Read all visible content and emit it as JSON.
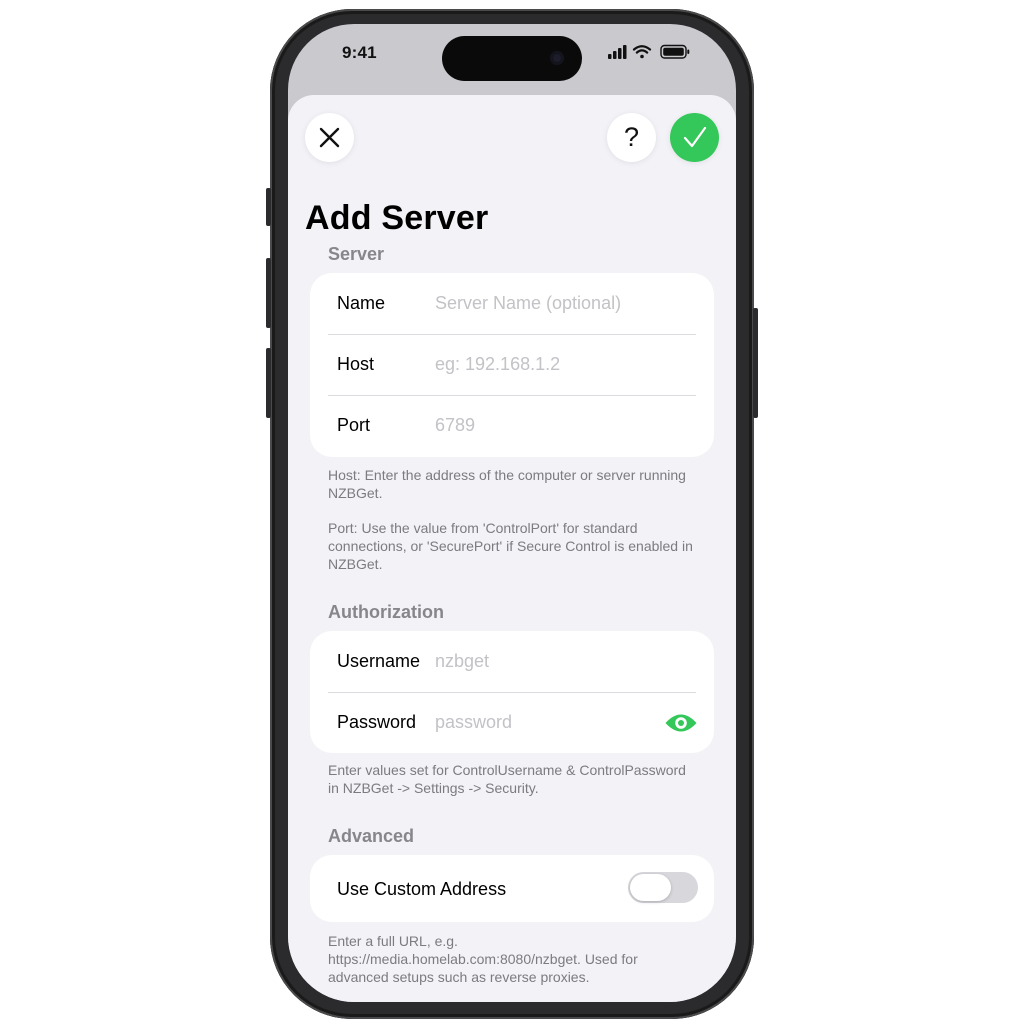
{
  "status_bar": {
    "time": "9:41"
  },
  "nav": {
    "title": "Add Server",
    "help_label": "?"
  },
  "server_section": {
    "header": "Server",
    "rows": [
      {
        "label": "Name",
        "placeholder": "Server Name (optional)"
      },
      {
        "label": "Host",
        "placeholder": "eg: 192.168.1.2"
      },
      {
        "label": "Port",
        "placeholder": "6789"
      }
    ],
    "footer_host": "Host: Enter the address of the computer or server running NZBGet.",
    "footer_port": "Port: Use the value from 'ControlPort' for standard connections, or 'SecurePort' if Secure Control is enabled in NZBGet."
  },
  "auth_section": {
    "header": "Authorization",
    "rows": [
      {
        "label": "Username",
        "placeholder": "nzbget"
      },
      {
        "label": "Password",
        "placeholder": "password"
      }
    ],
    "footer": "Enter values set for ControlUsername & ControlPassword in NZBGet -> Settings -> Security."
  },
  "advanced_section": {
    "header": "Advanced",
    "toggle_label": "Use Custom Address",
    "toggle_on": false,
    "footer": "Enter a full URL, e.g. https://media.homelab.com:8080/nzbget. Used for advanced setups such as reverse proxies."
  },
  "colors": {
    "accent": "#34c759",
    "placeholder": "#c2c2c7",
    "background": "#f2f2f7"
  },
  "icons": [
    "close-icon",
    "help-icon",
    "checkmark-icon",
    "eye-icon",
    "signal-icon",
    "wifi-icon",
    "battery-icon"
  ]
}
